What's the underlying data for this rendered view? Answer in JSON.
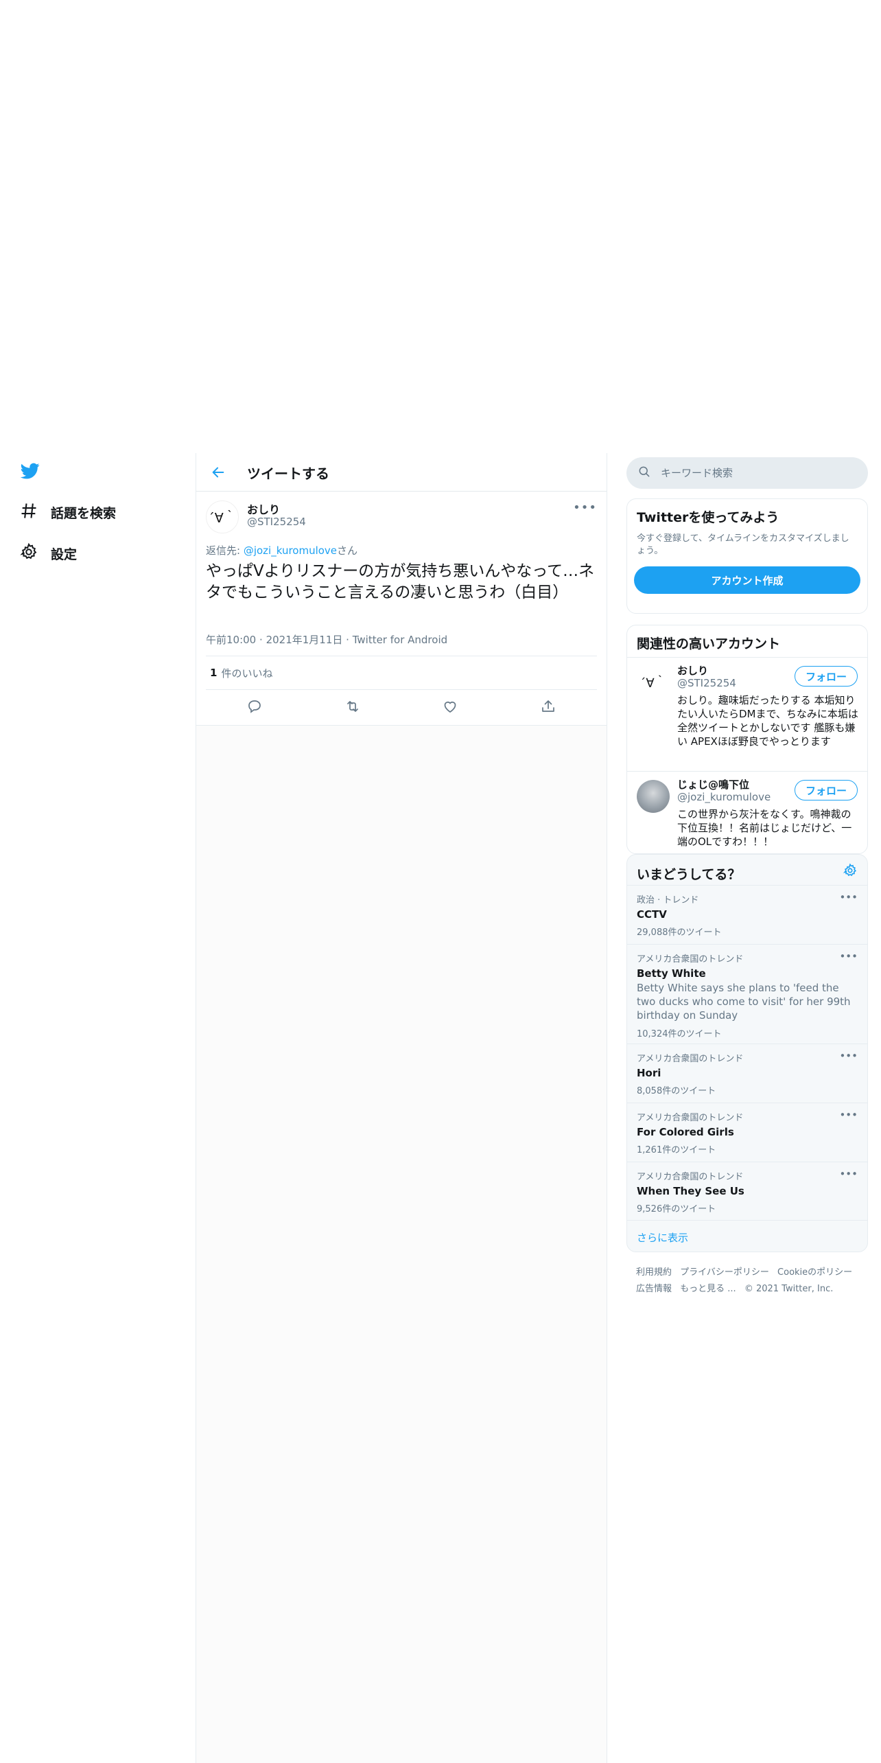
{
  "header": {
    "title": "ツイートする"
  },
  "nav": {
    "items": [
      {
        "label": "話題を検索",
        "icon": "hashtag-icon"
      },
      {
        "label": "設定",
        "icon": "gear-icon"
      }
    ]
  },
  "tweet": {
    "avatar_text": "´∀｀",
    "name": "おしり",
    "handle": "@STI25254",
    "reply_prefix": "返信先: ",
    "reply_to": "@jozi_kuromulove",
    "reply_suffix": "さん",
    "text": "やっぱVよりリスナーの方が気持ち悪いんやなって…ネタでもこういうこと言えるの凄いと思うわ（白目）",
    "time": "午前10:00",
    "date": "2021年1月11日",
    "source": "Twitter for Android",
    "likes_count": "1",
    "likes_label": "件のいいね"
  },
  "search": {
    "placeholder": "キーワード検索"
  },
  "signup": {
    "title": "Twitterを使ってみよう",
    "subtitle": "今すぐ登録して、タイムラインをカスタマイズしましょう。",
    "button": "アカウント作成"
  },
  "related": {
    "title": "関連性の高いアカウント",
    "follow_label": "フォロー",
    "accounts": [
      {
        "avatar_text": "´∀｀",
        "name": "おしり",
        "handle": "@STI25254",
        "bio": "おしり。趣味垢だったりする 本垢知りたい人いたらDMまで、ちなみに本垢は全然ツイートとかしないです 艦豚も嫌い APEXほぼ野良でやっとります"
      },
      {
        "avatar_text": "",
        "name": "じょじ@鳴下位",
        "handle": "@jozi_kuromulove",
        "bio": "この世界から灰汁をなくす。鳴神裁の下位互換！！名前はじょじだけど、一端のOLですわ！！！"
      }
    ]
  },
  "trends": {
    "title": "いまどうしてる？",
    "items": [
      {
        "context": "政治 · トレンド",
        "name": "CCTV",
        "description": "",
        "count": "29,088件のツイート"
      },
      {
        "context": "アメリカ合衆国のトレンド",
        "name": "Betty White",
        "description": "Betty White says she plans to 'feed the two ducks who come to visit' for her 99th birthday on Sunday",
        "count": "10,324件のツイート"
      },
      {
        "context": "アメリカ合衆国のトレンド",
        "name": "Hori",
        "description": "",
        "count": "8,058件のツイート"
      },
      {
        "context": "アメリカ合衆国のトレンド",
        "name": "For Colored Girls",
        "description": "",
        "count": "1,261件のツイート"
      },
      {
        "context": "アメリカ合衆国のトレンド",
        "name": "When They See Us",
        "description": "",
        "count": "9,526件のツイート"
      }
    ],
    "show_more": "さらに表示"
  },
  "footer": {
    "links": [
      "利用規約",
      "プライバシーポリシー",
      "Cookieのポリシー",
      "広告情報",
      "もっと見る ..."
    ],
    "copyright": "© 2021 Twitter, Inc."
  },
  "colors": {
    "accent": "#1da1f2",
    "text": "#14171a",
    "muted": "#657786",
    "border": "#e6ecf0"
  }
}
